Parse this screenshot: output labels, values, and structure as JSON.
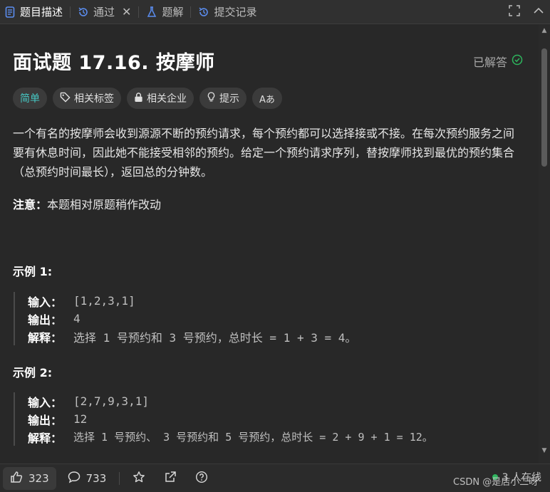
{
  "tabs": [
    {
      "label": "题目描述",
      "icon": "document-icon",
      "active": true
    },
    {
      "label": "通过",
      "icon": "history-icon",
      "closable": true
    },
    {
      "label": "题解",
      "icon": "flask-icon"
    },
    {
      "label": "提交记录",
      "icon": "history-icon"
    }
  ],
  "problem": {
    "title": "面试题 17.16. 按摩师",
    "status": "已解答",
    "tags": [
      "简单",
      "相关标签",
      "相关企业",
      "提示",
      "Aあ"
    ],
    "description": "一个有名的按摩师会收到源源不断的预约请求，每个预约都可以选择接或不接。在每次预约服务之间要有休息时间，因此她不能接受相邻的预约。给定一个预约请求序列，替按摩师找到最优的预约集合（总预约时间最长），返回总的分钟数。",
    "note_label": "注意：",
    "note_text": "本题相对原题稍作改动"
  },
  "examples": [
    {
      "title": "示例 1:",
      "input_label": "输入：",
      "input": "[1,2,3,1]",
      "output_label": "输出：",
      "output": "4",
      "explain_label": "解释：",
      "explain": "选择 1 号预约和 3 号预约，总时长 = 1 + 3 = 4。"
    },
    {
      "title": "示例 2:",
      "input_label": "输入：",
      "input": "[2,7,9,3,1]",
      "output_label": "输出：",
      "output": "12",
      "explain_label": "解释：",
      "explain": "选择 1 号预约、 3 号预约和 5 号预约，总时长 = 2 + 9 + 1 = 12。"
    }
  ],
  "footer": {
    "likes": "323",
    "comments": "733",
    "online": "3 人在线",
    "watermark": "CSDN @是店小二呀"
  },
  "colors": {
    "easy": "#46c6c2",
    "solved": "#2db55d"
  }
}
